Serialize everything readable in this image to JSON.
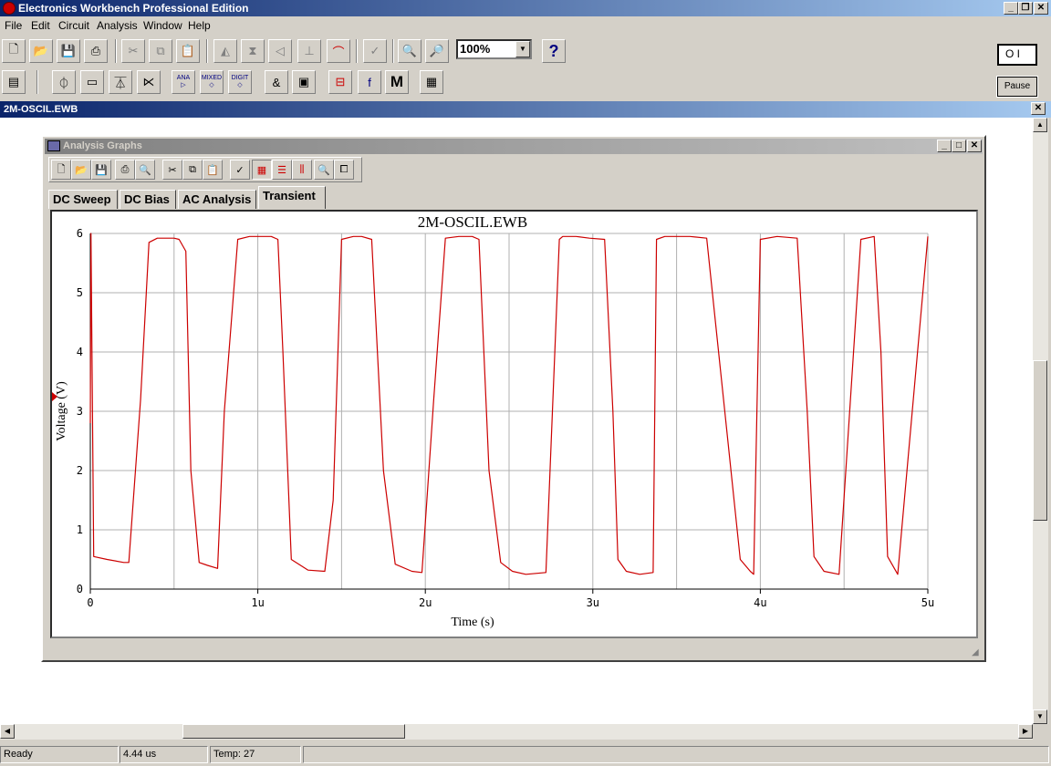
{
  "app": {
    "title": "Electronics Workbench Professional Edition",
    "controls": {
      "minimize": "_",
      "restore": "❐",
      "close": "✕"
    }
  },
  "menu": [
    "File",
    "Edit",
    "Circuit",
    "Analysis",
    "Window",
    "Help"
  ],
  "toolbar": {
    "zoom_value": "100%",
    "help_label": "?",
    "pause_label": "Pause",
    "power_label": "O I",
    "parts_labels": {
      "ana": "ANA",
      "mixed": "MIXED",
      "digit": "DIGIT",
      "misc": "M"
    }
  },
  "document": {
    "title": "2M-OSCIL.EWB"
  },
  "graph_window": {
    "title": "Analysis Graphs",
    "tabs": [
      "DC Sweep",
      "DC Bias",
      "AC Analysis",
      "Transient"
    ],
    "active_tab": "Transient"
  },
  "chart_data": {
    "type": "line",
    "title": "2M-OSCIL.EWB",
    "xlabel": "Time (s)",
    "ylabel": "Voltage (V)",
    "xlim": [
      0,
      5
    ],
    "ylim": [
      0,
      6
    ],
    "x_unit": "u",
    "x_ticks": [
      "0",
      "1u",
      "2u",
      "3u",
      "4u",
      "5u"
    ],
    "y_ticks": [
      "0",
      "1",
      "2",
      "3",
      "4",
      "5",
      "6"
    ],
    "grid": true,
    "color": "#cc0000",
    "series": [
      {
        "x": [
          0,
          0.004,
          0.02,
          0.1,
          0.2,
          0.23,
          0.3,
          0.35,
          0.4,
          0.5,
          0.53,
          0.57,
          0.6,
          0.65,
          0.7,
          0.76,
          0.8,
          0.88,
          0.95,
          1.0,
          1.08,
          1.12,
          1.15,
          1.2,
          1.3,
          1.4,
          1.45,
          1.5,
          1.57,
          1.62,
          1.68,
          1.75,
          1.82,
          1.92,
          1.98,
          2.05,
          2.12,
          2.2,
          2.28,
          2.32,
          2.38,
          2.45,
          2.52,
          2.6,
          2.72,
          2.8,
          2.82,
          2.86,
          2.9,
          2.98,
          3.07,
          3.12,
          3.15,
          3.2,
          3.28,
          3.36,
          3.38,
          3.43,
          3.5,
          3.58,
          3.68,
          3.88,
          3.94,
          3.96,
          4.0,
          4.1,
          4.22,
          4.28,
          4.32,
          4.38,
          4.47,
          4.6,
          4.68,
          4.72,
          4.76,
          4.82,
          5.0
        ],
        "y": [
          2.8,
          6.0,
          0.55,
          0.5,
          0.45,
          0.45,
          3.2,
          5.85,
          5.92,
          5.92,
          5.9,
          5.7,
          2.0,
          0.45,
          0.4,
          0.35,
          3.0,
          5.9,
          5.95,
          5.95,
          5.95,
          5.9,
          4.0,
          0.5,
          0.32,
          0.3,
          1.5,
          5.9,
          5.95,
          5.95,
          5.9,
          2.0,
          0.42,
          0.3,
          0.28,
          3.2,
          5.92,
          5.95,
          5.95,
          5.9,
          2.0,
          0.45,
          0.3,
          0.25,
          0.28,
          5.9,
          5.95,
          5.95,
          5.95,
          5.92,
          5.9,
          3.0,
          0.5,
          0.3,
          0.25,
          0.28,
          5.9,
          5.95,
          5.95,
          5.95,
          5.92,
          0.5,
          0.3,
          0.25,
          5.9,
          5.95,
          5.92,
          3.0,
          0.55,
          0.3,
          0.25,
          5.9,
          5.95,
          4.0,
          0.55,
          0.25,
          5.95
        ]
      }
    ]
  },
  "status": {
    "state": "Ready",
    "time": "4.44 us",
    "temp": "Temp:  27"
  }
}
